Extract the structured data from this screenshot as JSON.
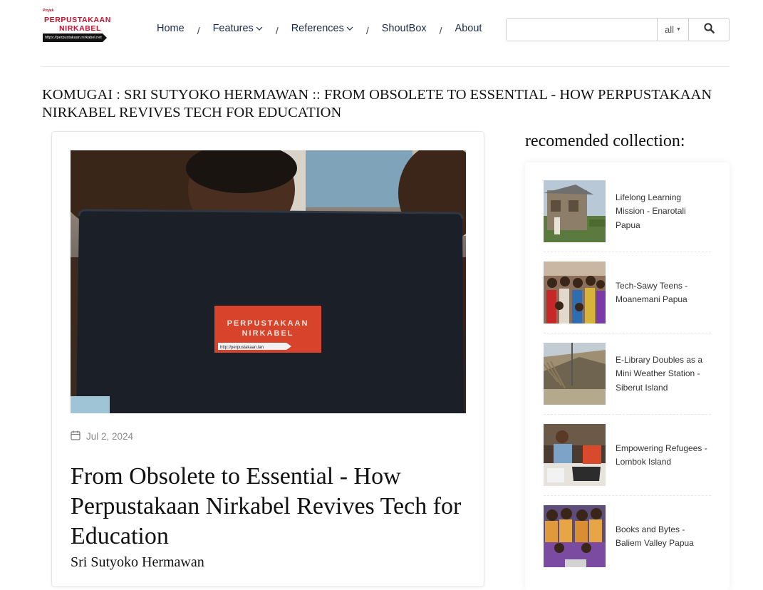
{
  "logo": {
    "tagline": "Projek",
    "line1": "PERPUSTAKAAN",
    "line2": "NIRKABEL",
    "url": "https://perpustakaan.nirkabel.net"
  },
  "nav": {
    "home": "Home",
    "features": "Features",
    "references": "References",
    "shoutbox": "ShoutBox",
    "about": "About",
    "separator": "/"
  },
  "search": {
    "value": "",
    "scope": "all"
  },
  "page": {
    "headline": "KOMUGAI : SRI SUTYOKO HERMAWAN :: FROM OBSOLETE TO ESSENTIAL - HOW PERPUSTAKAAN NIRKABEL REVIVES TECH FOR EDUCATION"
  },
  "article": {
    "laptop_brand_line1": "PERPUSTAKAAN",
    "laptop_brand_line2": "NIRKABEL",
    "laptop_brand_url": "http://perpustakaan.lan",
    "date": "Jul 2, 2024",
    "title": "From Obsolete to Essential - How Perpustakaan Nirkabel Revives Tech for Education",
    "author": "Sri Sutyoko Hermawan"
  },
  "sidebar": {
    "heading": "recomended collection:",
    "items": [
      {
        "label": "Lifelong Learning Mission - Enarotali Papua"
      },
      {
        "label": "Tech-Sawy Teens - Moanemani Papua"
      },
      {
        "label": "E-Library Doubles as a Mini Weather Station - Siberut Island"
      },
      {
        "label": "Empowering Refugees - Lombok Island"
      },
      {
        "label": "Books and Bytes - Baliem Valley Papua"
      }
    ]
  },
  "colors": {
    "brand_red": "#c8102e",
    "nav_text": "#1c2a49",
    "muted": "#8a8a8a"
  }
}
